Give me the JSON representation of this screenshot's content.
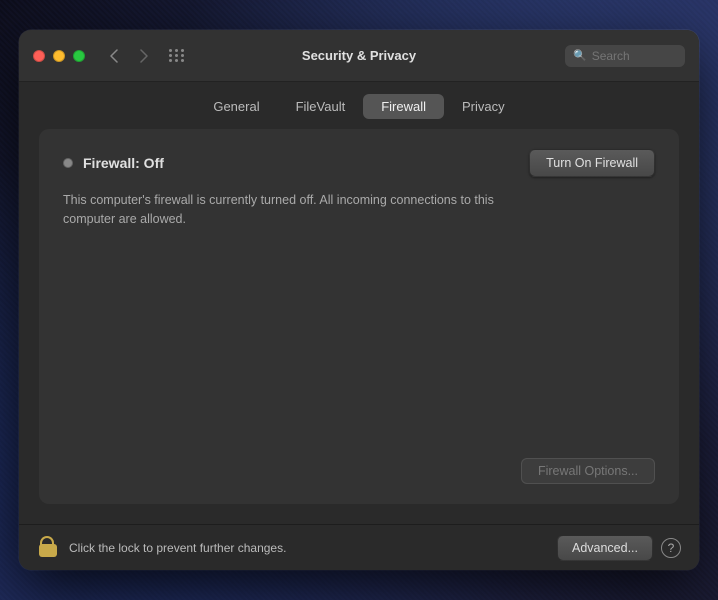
{
  "window": {
    "title": "Security & Privacy",
    "traffic_lights": [
      "red",
      "yellow",
      "green"
    ]
  },
  "search": {
    "placeholder": "Search"
  },
  "tabs": [
    {
      "id": "general",
      "label": "General",
      "active": false
    },
    {
      "id": "filevault",
      "label": "FileVault",
      "active": false
    },
    {
      "id": "firewall",
      "label": "Firewall",
      "active": true
    },
    {
      "id": "privacy",
      "label": "Privacy",
      "active": false
    }
  ],
  "firewall": {
    "status_dot_color": "#888888",
    "status_label": "Firewall: Off",
    "turn_on_label": "Turn On Firewall",
    "description": "This computer's firewall is currently turned off. All incoming connections to this computer are allowed.",
    "options_label": "Firewall Options..."
  },
  "bottom": {
    "lock_text": "Click the lock to prevent further changes.",
    "advanced_label": "Advanced...",
    "help_label": "?"
  }
}
